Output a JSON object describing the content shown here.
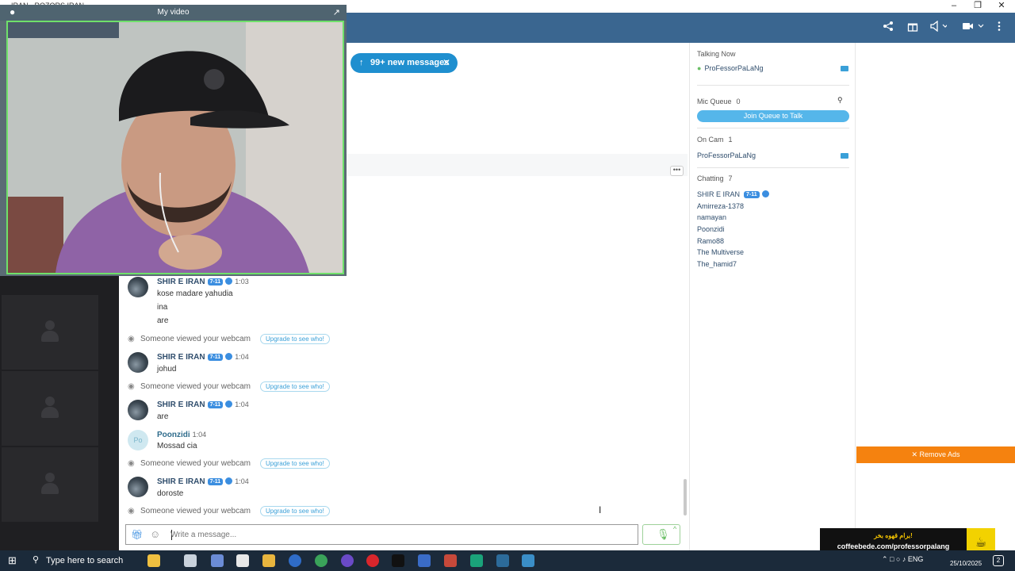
{
  "window": {
    "title": "IRAN - ROZORS IRAN",
    "minimize_icon": "minimize-icon",
    "restore_icon": "restore-icon",
    "close_icon": "close-icon"
  },
  "header": {
    "icons": [
      "share-icon",
      "gift-icon",
      "broadcast-icon",
      "camera-icon",
      "more-vertical-icon"
    ]
  },
  "my_video": {
    "title": "My video",
    "popout_icon": "popout-icon"
  },
  "new_messages": {
    "label": "99+ new messages",
    "arrow": "↑",
    "close": "✕"
  },
  "messages": {
    "more_label": "•••",
    "m1": {
      "name": "SHIR E IRAN",
      "badge": "7-11",
      "time": "1:03",
      "lines": [
        "kose madare yahudia",
        "ina",
        "are"
      ]
    },
    "s1": {
      "text": "Someone viewed your webcam",
      "link": "Upgrade to see who!"
    },
    "m2": {
      "name": "SHIR E IRAN",
      "badge": "7-11",
      "time": "1:04",
      "lines": [
        "johud"
      ]
    },
    "s2": {
      "text": "Someone viewed your webcam",
      "link": "Upgrade to see who!"
    },
    "m3": {
      "name": "SHIR E IRAN",
      "badge": "7-11",
      "time": "1:04",
      "lines": [
        "are"
      ]
    },
    "m4": {
      "name": "Poonzidi",
      "avatar_initials": "Po",
      "time": "1:04",
      "lines": [
        "Mossad cia"
      ]
    },
    "s3": {
      "text": "Someone viewed your webcam",
      "link": "Upgrade to see who!"
    },
    "m5": {
      "name": "SHIR E IRAN",
      "badge": "7-11",
      "time": "1:04",
      "lines": [
        "doroste"
      ]
    },
    "s4": {
      "text": "Someone viewed your webcam",
      "link": "Upgrade to see who!"
    }
  },
  "composer": {
    "placeholder": "Write a message..."
  },
  "panel": {
    "talking_now": {
      "title": "Talking Now",
      "user": "ProFessorPaLaNg"
    },
    "mic_queue": {
      "title": "Mic Queue",
      "count": "0",
      "join": "Join Queue to Talk"
    },
    "on_cam": {
      "title": "On Cam",
      "count": "1",
      "user": "ProFessorPaLaNg"
    },
    "chatting": {
      "title": "Chatting",
      "count": "7",
      "users": [
        "SHIR E IRAN",
        "Amirreza-1378",
        "namayan",
        "Poonzidi",
        "Ramo88",
        "The Multiverse",
        "The_hamid7"
      ],
      "first_user_badge": "7-11"
    }
  },
  "ads": {
    "remove_label": "✕ Remove Ads",
    "banner_line1": "برام قهوه بخر!",
    "banner_line2": "coffeebede.com/professorpalang"
  },
  "taskbar": {
    "search_placeholder": "Type here to search",
    "language": "ENG",
    "date": "25/10/2025",
    "notification_count": "2"
  },
  "colors": {
    "header": "#3a6690",
    "accent": "#1f8fcf",
    "ad_orange": "#f5820f",
    "video_border": "#6fe06a"
  }
}
